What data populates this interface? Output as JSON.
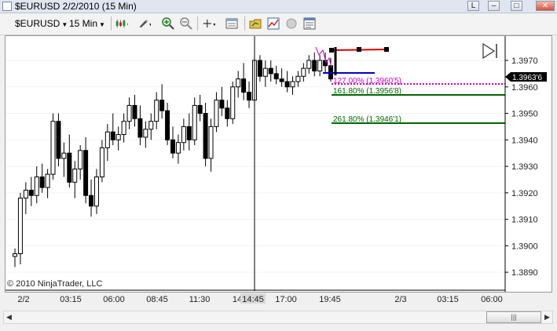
{
  "window": {
    "title": "$EURUSD  2/2/2010 (15 Min)",
    "buttons": [
      "L",
      "–",
      "□",
      "✕"
    ]
  },
  "toolbar": {
    "instrument": "$EURUSD",
    "interval": "15 Min",
    "icons": [
      "chart-style-icon",
      "drawing-tool-icon",
      "zoom-in-icon",
      "zoom-out-icon",
      "crosshair-icon",
      "data-box-icon",
      "properties-icon",
      "strategies-icon",
      "indicators-icon",
      "chart-trader-icon",
      "print-icon"
    ]
  },
  "chart": {
    "copyright": "© 2010 NinjaTrader, LLC",
    "x_axis_labels": [
      "2/2",
      "03:15",
      "06:00",
      "08:45",
      "11:30",
      "14",
      "14:45",
      "17:00",
      "19:45",
      "2/3",
      "03:15",
      "06:00"
    ],
    "y_axis_labels": [
      "1.3970",
      "1.3960",
      "1.3950",
      "1.3940",
      "1.3930",
      "1.3920",
      "1.3910",
      "1.3900",
      "1.3890"
    ],
    "price_marker": "1.3963'6",
    "fib_labels": [
      "127.00% (1.3960'5)",
      "161.80% (1.3956'8)",
      "261.80% (1.3946'1)"
    ],
    "colors": {
      "candle": "#000000",
      "fib127": "#cc00cc",
      "fib161": "#006600",
      "fib261": "#006600",
      "trend_red": "#dd0000",
      "trend_blue": "#0000cc"
    },
    "chart_data": {
      "type": "candlestick",
      "title": "$EURUSD 2/2/2010 (15 Min)",
      "y_range": [
        1.3885,
        1.3978
      ],
      "candles": [
        [
          1.3896,
          1.3899,
          1.3892,
          1.3897
        ],
        [
          1.3897,
          1.392,
          1.3893,
          1.3918
        ],
        [
          1.3918,
          1.3924,
          1.3912,
          1.3921
        ],
        [
          1.3921,
          1.3926,
          1.3915,
          1.3919
        ],
        [
          1.3919,
          1.393,
          1.3916,
          1.3926
        ],
        [
          1.3926,
          1.3931,
          1.392,
          1.3922
        ],
        [
          1.3922,
          1.3929,
          1.3918,
          1.3927
        ],
        [
          1.3927,
          1.395,
          1.3925,
          1.3947
        ],
        [
          1.3947,
          1.395,
          1.393,
          1.3933
        ],
        [
          1.3933,
          1.3939,
          1.3926,
          1.3935
        ],
        [
          1.3935,
          1.3942,
          1.3922,
          1.3924
        ],
        [
          1.3924,
          1.3932,
          1.3918,
          1.3929
        ],
        [
          1.3929,
          1.3938,
          1.3925,
          1.3936
        ],
        [
          1.3936,
          1.3941,
          1.3916,
          1.3919
        ],
        [
          1.3919,
          1.3925,
          1.3911,
          1.3915
        ],
        [
          1.3915,
          1.3929,
          1.3912,
          1.3926
        ],
        [
          1.3926,
          1.394,
          1.3924,
          1.3937
        ],
        [
          1.3937,
          1.3946,
          1.3932,
          1.3943
        ],
        [
          1.3943,
          1.395,
          1.3938,
          1.394
        ],
        [
          1.394,
          1.3945,
          1.3936,
          1.3942
        ],
        [
          1.3942,
          1.395,
          1.3939,
          1.3947
        ],
        [
          1.3947,
          1.3956,
          1.3944,
          1.3953
        ],
        [
          1.3953,
          1.3957,
          1.3945,
          1.3948
        ],
        [
          1.3948,
          1.3953,
          1.3938,
          1.3941
        ],
        [
          1.3941,
          1.3947,
          1.3937,
          1.3944
        ],
        [
          1.3944,
          1.395,
          1.394,
          1.3947
        ],
        [
          1.3947,
          1.3958,
          1.3944,
          1.3955
        ],
        [
          1.3955,
          1.3961,
          1.3948,
          1.3951
        ],
        [
          1.3951,
          1.3954,
          1.3938,
          1.394
        ],
        [
          1.394,
          1.3945,
          1.3933,
          1.3935
        ],
        [
          1.3935,
          1.3942,
          1.3931,
          1.3939
        ],
        [
          1.3939,
          1.3948,
          1.3936,
          1.3945
        ],
        [
          1.3945,
          1.395,
          1.3936,
          1.394
        ],
        [
          1.394,
          1.3956,
          1.3938,
          1.3953
        ],
        [
          1.3953,
          1.3957,
          1.3947,
          1.395
        ],
        [
          1.395,
          1.3954,
          1.393,
          1.3933
        ],
        [
          1.3933,
          1.3948,
          1.3928,
          1.3945
        ],
        [
          1.3945,
          1.3958,
          1.3943,
          1.3955
        ],
        [
          1.3955,
          1.396,
          1.3949,
          1.3952
        ],
        [
          1.3952,
          1.3955,
          1.3945,
          1.3948
        ],
        [
          1.3948,
          1.3962,
          1.3946,
          1.396
        ],
        [
          1.396,
          1.3966,
          1.3956,
          1.3963
        ],
        [
          1.3963,
          1.3969,
          1.3955,
          1.3958
        ],
        [
          1.3958,
          1.3962,
          1.3952,
          1.3955
        ],
        [
          1.3955,
          1.3972,
          1.3953,
          1.397
        ],
        [
          1.397,
          1.3972,
          1.3962,
          1.3964
        ],
        [
          1.3964,
          1.397,
          1.396,
          1.3967
        ],
        [
          1.3967,
          1.397,
          1.3962,
          1.3965
        ],
        [
          1.3965,
          1.3968,
          1.3961,
          1.3963
        ],
        [
          1.3963,
          1.3967,
          1.396,
          1.3962
        ],
        [
          1.3962,
          1.3966,
          1.3958,
          1.396
        ],
        [
          1.396,
          1.3964,
          1.3957,
          1.3962
        ],
        [
          1.3962,
          1.3966,
          1.396,
          1.3964
        ],
        [
          1.3964,
          1.3969,
          1.3962,
          1.3967
        ],
        [
          1.3967,
          1.3972,
          1.3965,
          1.397
        ],
        [
          1.397,
          1.3973,
          1.3964,
          1.3966
        ],
        [
          1.3966,
          1.3972,
          1.3964,
          1.397
        ],
        [
          1.397,
          1.3973,
          1.3965,
          1.3968
        ],
        [
          1.3968,
          1.3971,
          1.3962,
          1.3963
        ]
      ]
    }
  },
  "scrollbar": {
    "thumb_label": "|||"
  }
}
